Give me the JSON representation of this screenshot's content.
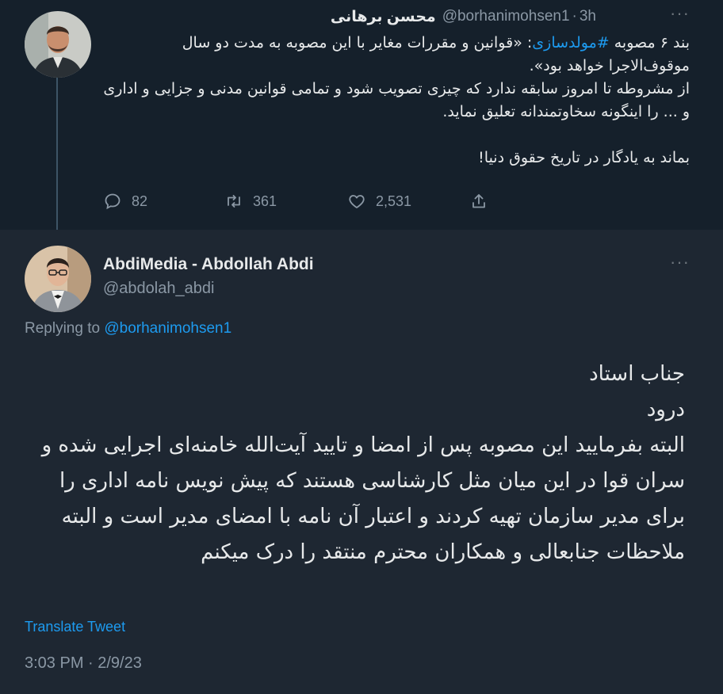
{
  "parent_tweet": {
    "author_name": "محسن برهانی",
    "handle": "@borhanimohsen1",
    "separator": "·",
    "time": "3h",
    "text_part1": "بند ۶ مصوبه ",
    "hashtag": "#مولدسازی",
    "text_part2": ": «قوانین و مقررات مغایر با این مصوبه به مدت دو سال موقوف‌الاجرا خواهد بود».",
    "line2": "از مشروطه تا امروز سابقه ندارد که چیزی تصویب شود و تمامی قوانین مدنی و جزایی و اداری و ... را اینگونه سخاوتمندانه تعلیق نماید.",
    "line3": "بماند به یادگار در تاریخ حقوق دنیا!",
    "reply_count": "82",
    "retweet_count": "361",
    "like_count": "2,531"
  },
  "reply_tweet": {
    "author_name": "AbdiMedia - Abdollah Abdi",
    "handle": "@abdolah_abdi",
    "replying_prefix": "Replying to",
    "replying_handle": "@borhanimohsen1",
    "lines": [
      "جناب استاد",
      "درود",
      "البته بفرمایید این مصوبه پس از امضا و تایید آیت‌الله خامنه‌ای اجرایی شده و سران قوا در این میان مثل کارشناسی هستند که پیش نویس نامه اداری را برای مدیر سازمان تهیه کردند و اعتبار آن نامه با امضای مدیر است و البته ملاحظات جنابعالی و همکاران محترم منتقد را درک میکنم"
    ],
    "translate_label": "Translate Tweet",
    "timestamp": "3:03 PM · 2/9/23"
  },
  "more_label": "···",
  "icons": [
    "reply-icon",
    "retweet-icon",
    "like-icon",
    "share-icon",
    "more-icon"
  ],
  "colors": {
    "parent_background": "#15202b",
    "reply_background": "#1e2732",
    "accent": "#1d9bf0",
    "secondary_text": "#8b98a5",
    "primary_text": "#e7e9ea"
  }
}
